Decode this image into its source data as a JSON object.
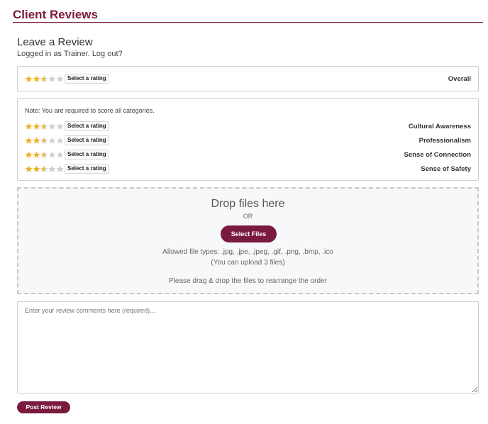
{
  "colors": {
    "brand": "#7a1a3e",
    "star_filled": "#f0b429",
    "star_empty": "#d0d0d0"
  },
  "header": {
    "title": "Client Reviews"
  },
  "review": {
    "heading": "Leave a Review",
    "logged_in_text": "Logged in as Trainer.",
    "logout_text": "Log out?"
  },
  "overall": {
    "rating": 2.5,
    "max": 5,
    "select_label": "Select a rating",
    "label": "Overall"
  },
  "categories": {
    "note": "Note: You are required to score all categories.",
    "items": [
      {
        "label": "Cultural Awareness",
        "rating": 2.5,
        "max": 5,
        "select_label": "Select a rating"
      },
      {
        "label": "Professionalism",
        "rating": 2.5,
        "max": 5,
        "select_label": "Select a rating"
      },
      {
        "label": "Sense of Connection",
        "rating": 2.5,
        "max": 5,
        "select_label": "Select a rating"
      },
      {
        "label": "Sense of Safety",
        "rating": 2.5,
        "max": 5,
        "select_label": "Select a rating"
      }
    ]
  },
  "dropzone": {
    "title": "Drop files here",
    "or_text": "OR",
    "select_button": "Select Files",
    "allowed_types": "Allowed file types: .jpg, .jpe, .jpeg, .gif, .png, .bmp, .ico",
    "upload_limit": "(You can upload 3 files)",
    "drag_note": "Please drag & drop the files to rearrange the order"
  },
  "comments": {
    "placeholder": "Enter your review comments here (required)...",
    "value": ""
  },
  "actions": {
    "post_label": "Post Review"
  }
}
